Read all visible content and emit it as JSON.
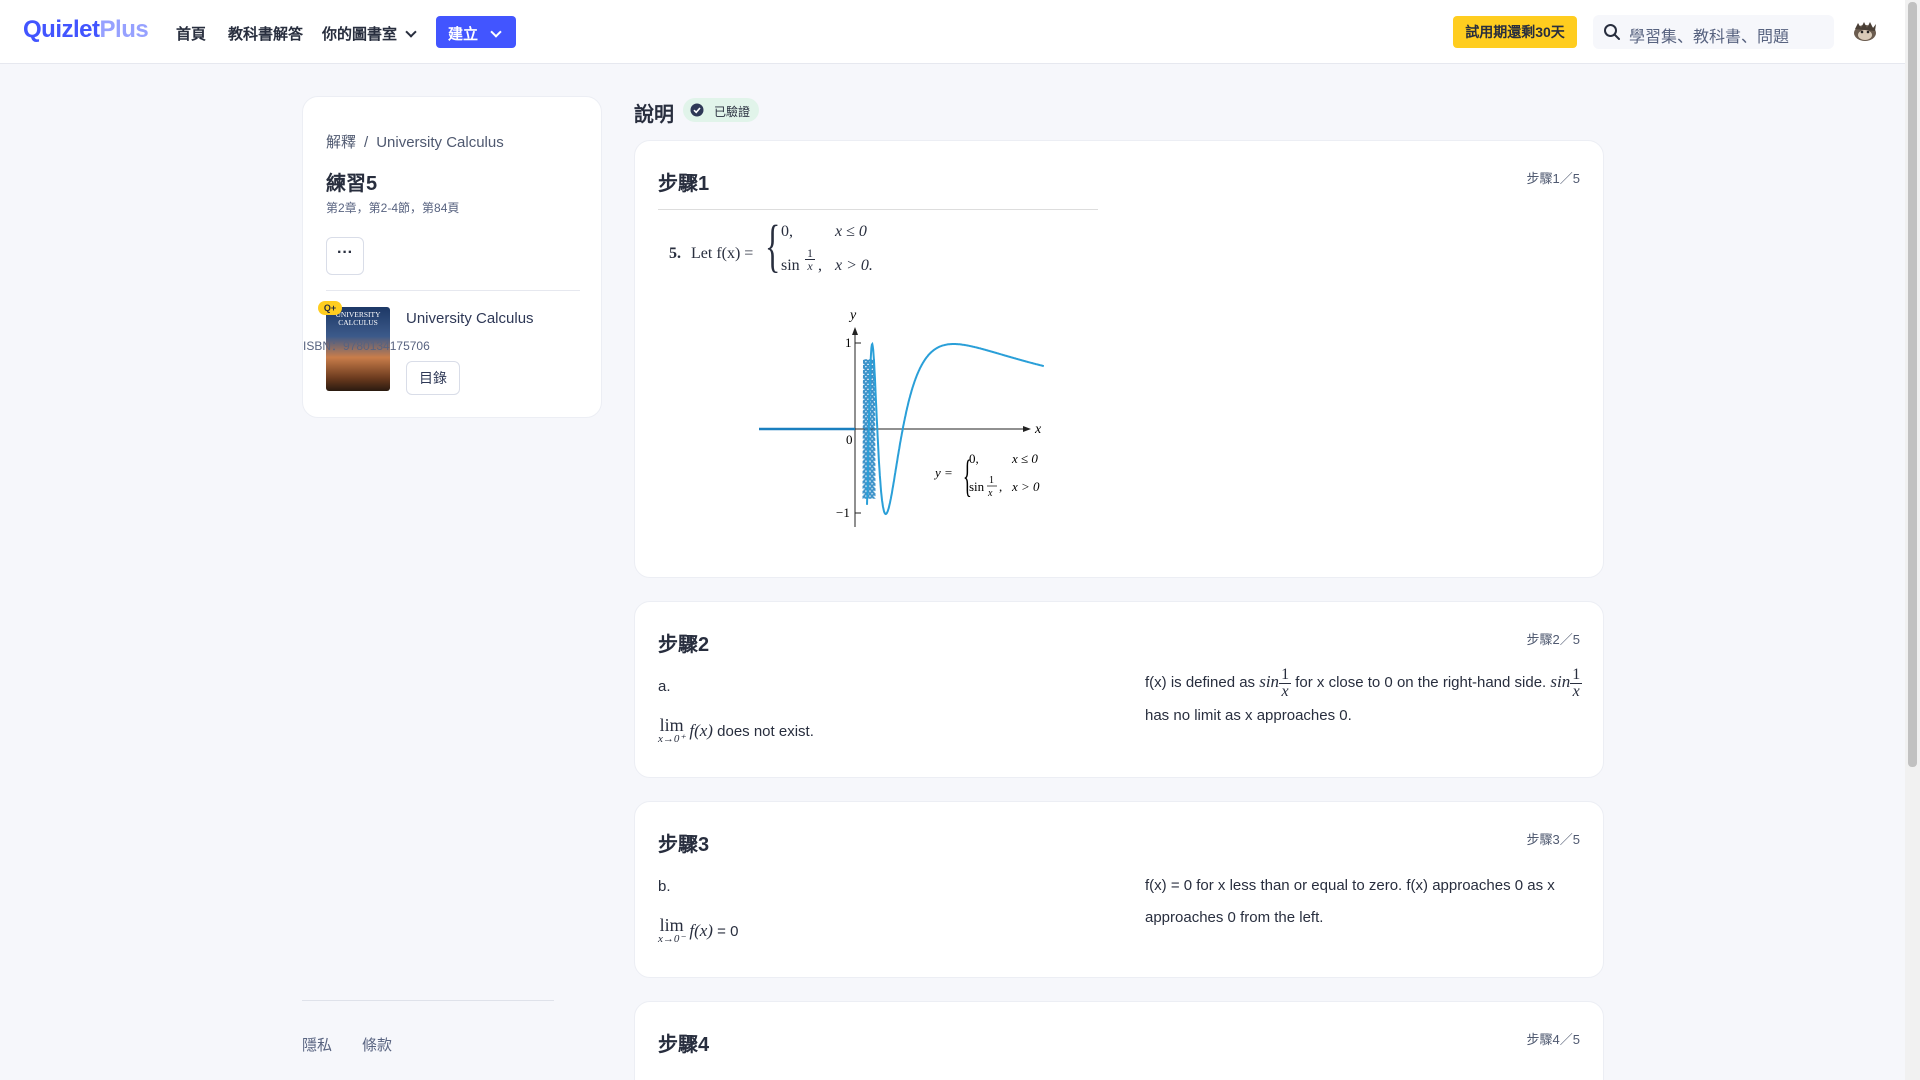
{
  "header": {
    "logo_main": "Quizlet",
    "logo_plus": "Plus",
    "nav": [
      "首頁",
      "教科書解答",
      "你的圖書室"
    ],
    "create_label": "建立",
    "trial_label": "試用期還剩30天",
    "search_placeholder": "學習集、教科書、問題"
  },
  "sidebar": {
    "breadcrumb": [
      "解釋",
      "University Calculus"
    ],
    "exercise_title": "練習5",
    "exercise_meta": "第2章，第2-4節，第84頁",
    "more_label": "···",
    "book": {
      "badge": "Q+",
      "cover_text": "UNIVERSITY CALCULUS",
      "title": "University Calculus",
      "isbn": "ISBN：9780134175706",
      "toc_label": "目錄"
    },
    "footer_links": [
      "隱私",
      "條款"
    ]
  },
  "explanation": {
    "title": "說明",
    "verified_label": "已驗證"
  },
  "steps": [
    {
      "heading": "步驟1",
      "counter": "步驟1／5",
      "problem_number": "5.",
      "problem_text": "Let f(x) =",
      "case1": "0,",
      "case1_cond": "x ≤ 0",
      "case2": "sin",
      "case2_cond": "x > 0.",
      "graph": {
        "x_label": "x",
        "y_label": "y",
        "tick_1": "1",
        "tick_0": "0",
        "tick_neg1": "−1",
        "legend_y": "y =",
        "legend_c1": "0,",
        "legend_c1_cond": "x ≤ 0",
        "legend_c2": "sin",
        "legend_c2_cond": "x > 0",
        "curve_color": "#2a9fd8"
      }
    },
    {
      "heading": "步驟2",
      "counter": "步驟2／5",
      "left_label": "a.",
      "lim_word": "lim",
      "lim_sub": "x→0⁺",
      "left_expr": "f(x)",
      "left_tail": "does not exist.",
      "right_text_1": "f(x) is defined as",
      "right_sin": "sin",
      "right_text_2": "for x close to 0 on the right-hand side.",
      "right_text_3": "has no limit as x approaches 0."
    },
    {
      "heading": "步驟3",
      "counter": "步驟3／5",
      "left_label": "b.",
      "lim_word": "lim",
      "lim_sub": "x→0⁻",
      "left_expr": "f(x)",
      "left_tail": "= 0",
      "right_text": "f(x) = 0 for x less than or equal to zero. f(x) approaches 0 as x approaches 0 from the left."
    },
    {
      "heading": "步驟4",
      "counter": "步驟4／5"
    }
  ],
  "colors": {
    "brand": "#4255ff",
    "trial": "#ffcd1f",
    "verified_bg": "#e1f4ea",
    "verified_icon": "#2e3856"
  }
}
